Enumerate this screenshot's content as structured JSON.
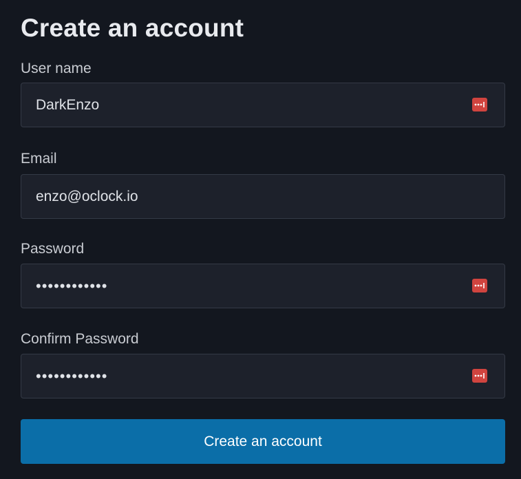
{
  "form": {
    "title": "Create an account",
    "fields": [
      {
        "label": "User name",
        "value": "DarkEnzo",
        "password_manager_icon": "lastpass-icon"
      },
      {
        "label": "Email",
        "value": "enzo@oclock.io"
      },
      {
        "label": "Password",
        "value": "••••••••••••",
        "password_manager_icon": "lastpass-icon"
      },
      {
        "label": "Confirm Password",
        "value": "••••••••••••",
        "password_manager_icon": "lastpass-icon"
      }
    ],
    "submit_label": "Create an account"
  },
  "colors": {
    "background": "#13171f",
    "input_background": "#1d212b",
    "button": "#0b6ea8",
    "icon_red": "#d0443f"
  }
}
